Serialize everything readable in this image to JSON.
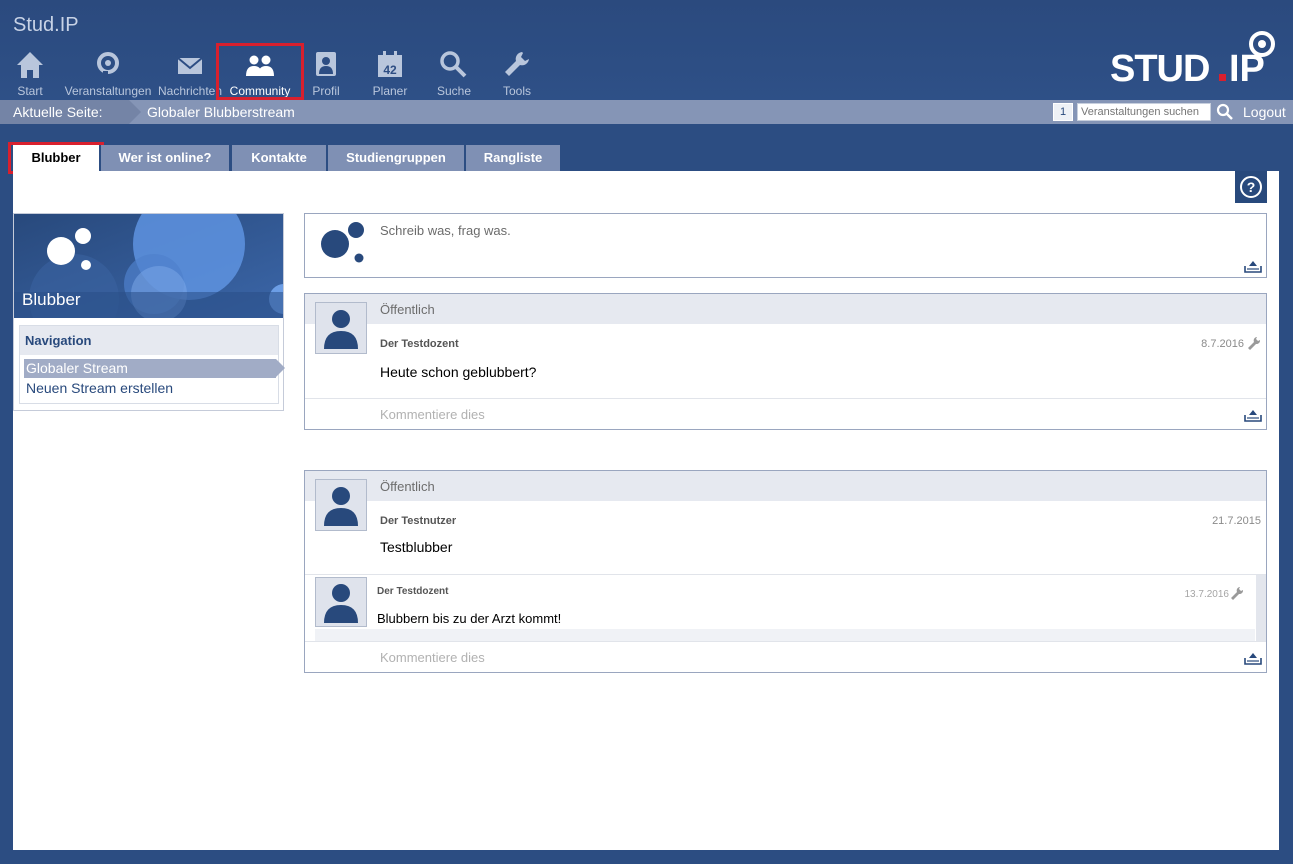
{
  "app": {
    "title": "Stud.IP"
  },
  "nav": [
    {
      "label": "Start",
      "icon": "home-icon"
    },
    {
      "label": "Veranstaltungen",
      "icon": "courses-icon"
    },
    {
      "label": "Nachrichten",
      "icon": "mail-icon"
    },
    {
      "label": "Community",
      "icon": "community-icon",
      "active": true
    },
    {
      "label": "Profil",
      "icon": "profile-icon"
    },
    {
      "label": "Planer",
      "icon": "calendar-icon"
    },
    {
      "label": "Suche",
      "icon": "search-icon"
    },
    {
      "label": "Tools",
      "icon": "wrench-icon"
    }
  ],
  "logo": {
    "text_left": "STUD",
    "text_right": "IP"
  },
  "breadcrumb": {
    "label": "Aktuelle Seite:",
    "page": "Globaler Blubberstream"
  },
  "header_right": {
    "badge": "1",
    "search_placeholder": "Veranstaltungen suchen",
    "logout": "Logout"
  },
  "tabs": [
    {
      "label": "Blubber",
      "active": true
    },
    {
      "label": "Wer ist online?"
    },
    {
      "label": "Kontakte"
    },
    {
      "label": "Studiengruppen"
    },
    {
      "label": "Rangliste"
    }
  ],
  "sidebar": {
    "title": "Blubber",
    "nav_heading": "Navigation",
    "links": [
      {
        "label": "Globaler Stream",
        "active": true
      },
      {
        "label": "Neuen Stream erstellen"
      }
    ]
  },
  "composer": {
    "placeholder": "Schreib was, frag was."
  },
  "posts": [
    {
      "visibility": "Öffentlich",
      "author": "Der Testdozent",
      "date": "8.7.2016",
      "text": "Heute schon geblubbert?",
      "comment_placeholder": "Kommentiere dies"
    },
    {
      "visibility": "Öffentlich",
      "author": "Der Testnutzer",
      "date": "21.7.2015",
      "text": "Testblubber",
      "reply": {
        "author": "Der Testdozent",
        "date": "13.7.2016",
        "text": "Blubbern bis zu der Arzt kommt!"
      },
      "comment_placeholder": "Kommentiere dies"
    }
  ],
  "colors": {
    "brand": "#28497c",
    "highlight": "#d8202e",
    "tab_bg": "#7f90b4"
  }
}
